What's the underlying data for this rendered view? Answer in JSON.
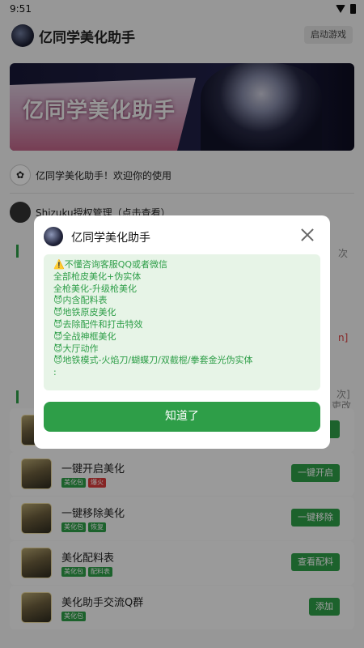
{
  "status_bar": {
    "time": "9:51"
  },
  "header": {
    "title": "亿同学美化助手",
    "launch_button": "启动游戏"
  },
  "banner": {
    "text": "亿同学美化助手"
  },
  "welcome": {
    "text": "亿同学美化助手！欢迎你的使用"
  },
  "shizuku": {
    "text": "Shizuku授权管理（点击查看）"
  },
  "bg_partial": {
    "right_text_1": "次",
    "right_text_2": "n]",
    "right_text_3": "次]",
    "right_text_4": "吏改"
  },
  "list_items": [
    {
      "name": "一键开启美化",
      "tags": [
        {
          "label": "美化包",
          "color": "green"
        },
        {
          "label": "爆火",
          "color": "red"
        }
      ],
      "button": "一键开启"
    },
    {
      "name": "一键移除美化",
      "tags": [
        {
          "label": "美化包",
          "color": "green"
        },
        {
          "label": "恢复",
          "color": "green"
        }
      ],
      "button": "一键移除"
    },
    {
      "name": "美化配料表",
      "tags": [
        {
          "label": "美化包",
          "color": "green"
        },
        {
          "label": "配料表",
          "color": "green"
        }
      ],
      "button": "查看配料"
    },
    {
      "name": "美化助手交流Q群",
      "tags": [
        {
          "label": "美化包",
          "color": "green"
        }
      ],
      "button": "添加"
    }
  ],
  "dialog": {
    "title": "亿同学美化助手",
    "lines": [
      "⚠️不懂咨询客服QQ或者微信",
      "全部枪皮美化+伪实体",
      "全枪美化-升级枪美化",
      "😈内含配料表",
      "😈地铁原皮美化",
      "😈去除配件和打击特效",
      "😈全战神框美化",
      "😈大厅动作",
      "😈地铁模式-火焰刀/蝴蝶刀/双截棍/拳套金光伪实体",
      ":"
    ],
    "confirm_button": "知道了"
  },
  "colors": {
    "accent": "#2e9e48",
    "tag_red": "#d93b3b",
    "dialog_body_bg": "#e7f4e7"
  }
}
